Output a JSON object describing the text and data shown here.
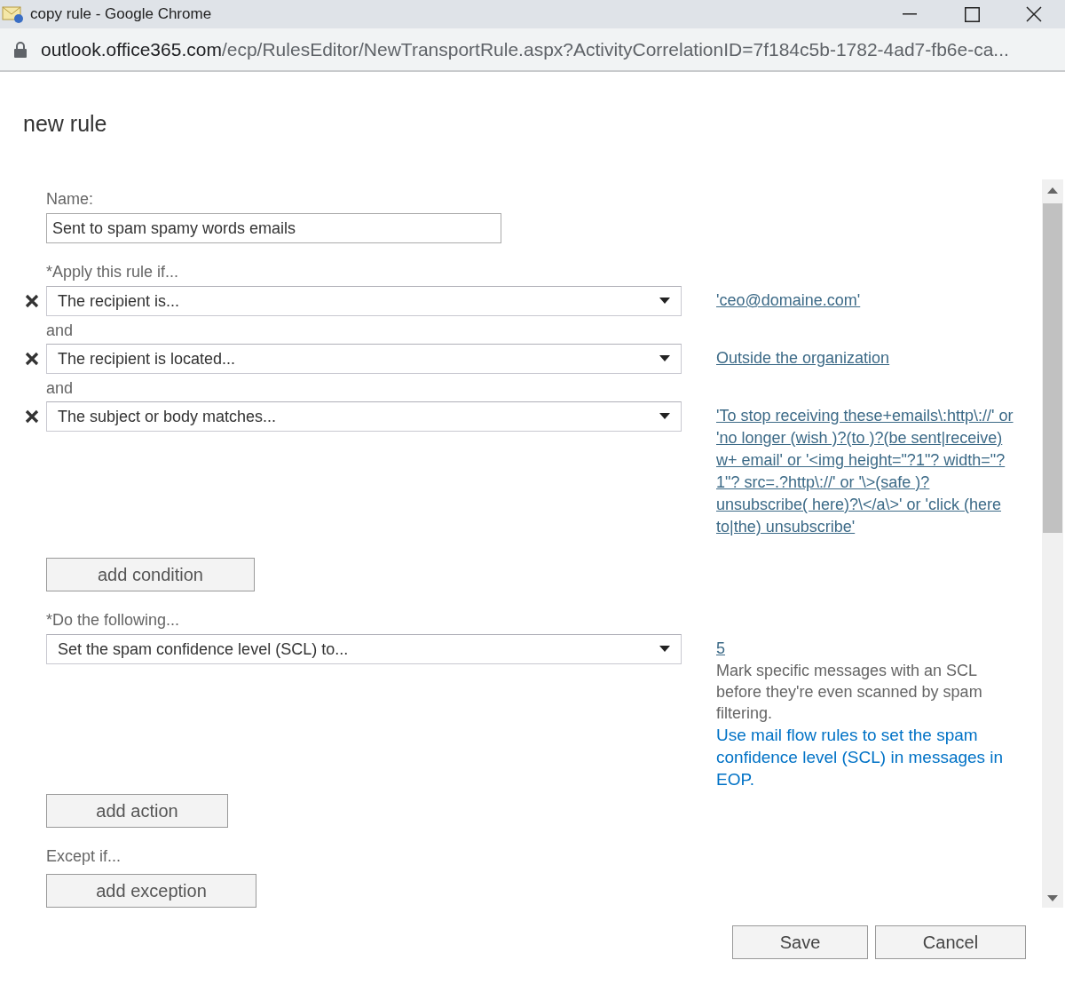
{
  "window": {
    "title": "copy rule - Google Chrome"
  },
  "address_bar": {
    "host": "outlook.office365.com",
    "path": "/ecp/RulesEditor/NewTransportRule.aspx?ActivityCorrelationID=7f184c5b-1782-4ad7-fb6e-ca..."
  },
  "dialog": {
    "title": "new rule",
    "name_field": {
      "label": "Name:",
      "value": "Sent to spam spamy words emails"
    },
    "conditions": {
      "label": "*Apply this rule if...",
      "items": [
        {
          "value": "The recipient is...",
          "link": "'ceo@domaine.com'"
        },
        {
          "prefix": "and",
          "value": "The recipient is located...",
          "link": "Outside the organization"
        },
        {
          "prefix": "and",
          "value": "The subject or body matches...",
          "link": "'To stop receiving these+emails\\:http\\://' or 'no longer (wish )?(to )?(be sent|receive) w+ email' or '<img height=\"?1\"? width=\"?1\"? src=.?http\\://' or '\\>(safe )?unsubscribe( here)?\\</a\\>' or 'click (here to|the) unsubscribe'"
        }
      ]
    },
    "add_condition": "add condition",
    "actions": {
      "label": "*Do the following...",
      "items": [
        {
          "value": "Set the spam confidence level (SCL) to...",
          "link": "5",
          "description": "Mark specific messages with an SCL before they're even scanned by spam filtering.",
          "help_link": "Use mail flow rules to set the spam confidence level (SCL) in messages in EOP."
        }
      ]
    },
    "add_action": "add action",
    "exceptions": {
      "label": "Except if...",
      "add_button": "add exception"
    }
  },
  "buttons": [
    {
      "label": "Save"
    },
    {
      "label": "Cancel"
    }
  ]
}
